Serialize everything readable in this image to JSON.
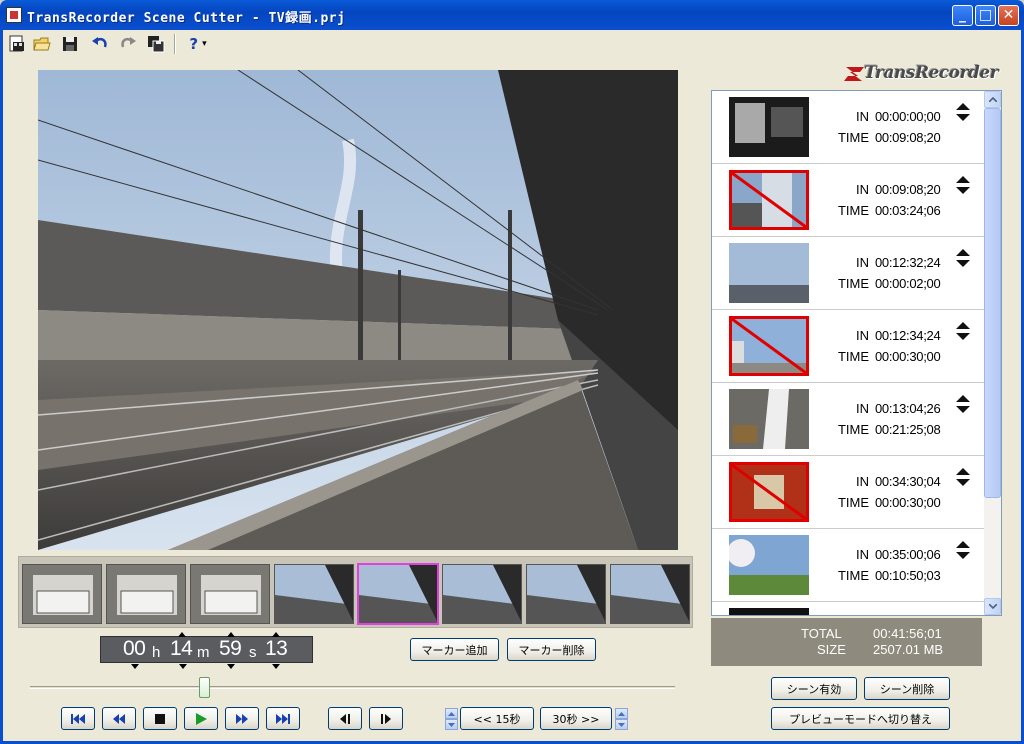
{
  "window": {
    "title": "TransRecorder Scene Cutter - TV録画.prj",
    "min_label": "_",
    "max_label": "□",
    "close_label": "✕"
  },
  "toolbar": {
    "items": [
      "new-project-icon",
      "open-folder-icon",
      "save-icon",
      "undo-icon",
      "redo-icon",
      "save-as-icon",
      "help-icon"
    ],
    "help_label": "?",
    "help_dropdown": "▾"
  },
  "logo": {
    "text": "TransRecorder"
  },
  "timecode": {
    "hours": "00",
    "h_unit": "h",
    "minutes": "14",
    "m_unit": "m",
    "seconds": "59",
    "s_unit": "s",
    "frames": "13"
  },
  "markers": {
    "add_label": "マーカー追加",
    "delete_label": "マーカー削除"
  },
  "transport": {
    "back_15": "<< 15秒",
    "fwd_30": "30秒 >>"
  },
  "scenes": [
    {
      "in_label": "IN",
      "in": "00:00:00;00",
      "time_label": "TIME",
      "time": "00:09:08;20",
      "enabled": true
    },
    {
      "in_label": "IN",
      "in": "00:09:08;20",
      "time_label": "TIME",
      "time": "00:03:24;06",
      "enabled": false
    },
    {
      "in_label": "IN",
      "in": "00:12:32;24",
      "time_label": "TIME",
      "time": "00:00:02;00",
      "enabled": true
    },
    {
      "in_label": "IN",
      "in": "00:12:34;24",
      "time_label": "TIME",
      "time": "00:00:30;00",
      "enabled": false
    },
    {
      "in_label": "IN",
      "in": "00:13:04;26",
      "time_label": "TIME",
      "time": "00:21:25;08",
      "enabled": true
    },
    {
      "in_label": "IN",
      "in": "00:34:30;04",
      "time_label": "TIME",
      "time": "00:00:30;00",
      "enabled": false
    },
    {
      "in_label": "IN",
      "in": "00:35:00;06",
      "time_label": "TIME",
      "time": "00:10:50;03",
      "enabled": true
    }
  ],
  "totals": {
    "total_label": "TOTAL",
    "total": "00:41:56;01",
    "size_label": "SIZE",
    "size": "2507.01 MB"
  },
  "scene_buttons": {
    "enable_label": "シーン有効",
    "delete_label": "シーン削除",
    "preview_label": "プレビューモードへ切り替え"
  },
  "colors": {
    "titlebar": "#0a4fcf",
    "selected_thumb": "#e040e0",
    "disabled_scene": "#e00000",
    "play_green": "#1a9b2a",
    "transport_blue": "#1a3fb0"
  },
  "seek": {
    "position_fraction": 0.27
  }
}
